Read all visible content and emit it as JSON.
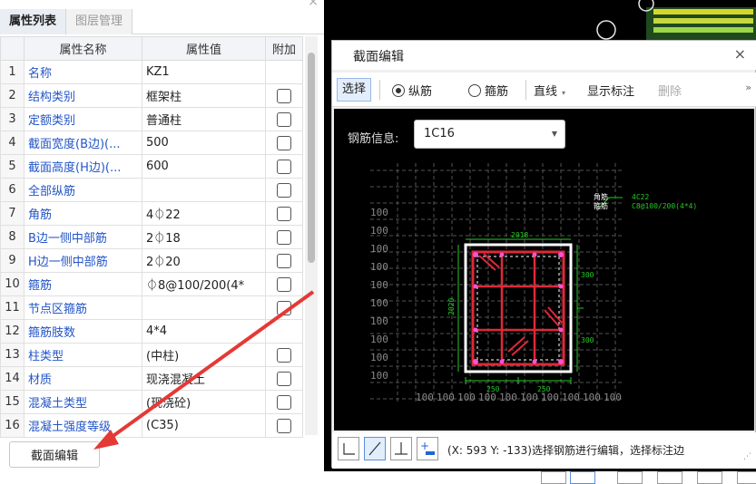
{
  "left_panel": {
    "tabs": [
      "属性列表",
      "图层管理"
    ],
    "close": "×",
    "columns": [
      "",
      "属性名称",
      "属性值",
      "附加"
    ],
    "rows": [
      {
        "n": "1",
        "name": "名称",
        "value": "KZ1",
        "check": false
      },
      {
        "n": "2",
        "name": "结构类别",
        "value": "框架柱",
        "check": true
      },
      {
        "n": "3",
        "name": "定额类别",
        "value": "普通柱",
        "check": true
      },
      {
        "n": "4",
        "name": "截面宽度(B边)(...",
        "value": "500",
        "check": true
      },
      {
        "n": "5",
        "name": "截面高度(H边)(...",
        "value": "600",
        "check": true
      },
      {
        "n": "6",
        "name": "全部纵筋",
        "value": "",
        "check": true
      },
      {
        "n": "7",
        "name": "角筋",
        "value": "4⏀22",
        "check": true
      },
      {
        "n": "8",
        "name": "B边一侧中部筋",
        "value": "2⏀18",
        "check": true
      },
      {
        "n": "9",
        "name": "H边一侧中部筋",
        "value": "2⏀20",
        "check": true
      },
      {
        "n": "10",
        "name": "箍筋",
        "value": "⏀8@100/200(4*",
        "check": true
      },
      {
        "n": "11",
        "name": "节点区箍筋",
        "value": "",
        "check": true
      },
      {
        "n": "12",
        "name": "箍筋肢数",
        "value": "4*4",
        "check": false
      },
      {
        "n": "13",
        "name": "柱类型",
        "value": "(中柱)",
        "check": true
      },
      {
        "n": "14",
        "name": "材质",
        "value": "现浇混凝土",
        "check": true
      },
      {
        "n": "15",
        "name": "混凝土类型",
        "value": "(现浇砼)",
        "check": true
      },
      {
        "n": "16",
        "name": "混凝土强度等级",
        "value": "(C35)",
        "check": true
      }
    ],
    "section_edit_button": "截面编辑"
  },
  "dialog": {
    "title": "截面编辑",
    "close": "×",
    "toolbar": {
      "select": "选择",
      "radio_longitudinal": "纵筋",
      "radio_stirrup": "箍筋",
      "line": "直线",
      "show_label": "显示标注",
      "delete": "删除",
      "more": "»"
    },
    "rebar_info_label": "钢筋信息:",
    "rebar_info_value": "1C16",
    "status_text": "(X: 593 Y: -133)选择钢筋进行编辑，选择标注边",
    "drawing": {
      "corner_label_1": "角筋",
      "corner_label_2": "箍筋",
      "annotation_1": "4C22",
      "annotation_2": "C8@100/200(4*4)",
      "dim_top": "2018",
      "dim_left": "2020",
      "dim_right_1": "300",
      "dim_right_2": "300",
      "dim_bottom_1": "250",
      "dim_bottom_2": "250",
      "grid_value": "100"
    }
  },
  "colors": {
    "accent_blue": "#2355c8",
    "annotation_arrow": "#e53935",
    "rebar_red": "#e0283a",
    "dimension_green": "#22cc22"
  }
}
